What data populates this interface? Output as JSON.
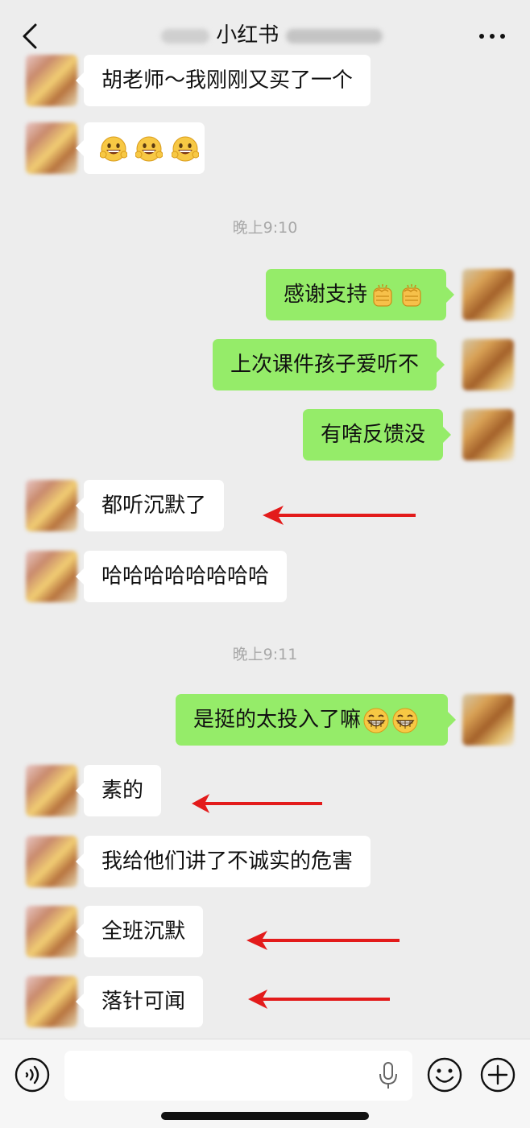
{
  "header": {
    "title_visible": "小红书",
    "back_icon": "chevron-left-icon",
    "more_icon": "ellipsis-icon"
  },
  "messages": [
    {
      "side": "left",
      "text": "胡老师～我刚刚又买了一个"
    },
    {
      "side": "left",
      "emoji": [
        "grinning-face",
        "grinning-face",
        "grinning-face"
      ]
    },
    {
      "side": "right",
      "text": "感谢支持",
      "emoji": [
        "raised-fist",
        "raised-fist"
      ]
    },
    {
      "side": "right",
      "text": "上次课件孩子爱听不"
    },
    {
      "side": "right",
      "text": "有啥反馈没"
    },
    {
      "side": "left",
      "text": "都听沉默了",
      "annotated_arrow": true
    },
    {
      "side": "left",
      "text": "哈哈哈哈哈哈哈哈"
    },
    {
      "side": "right",
      "text": "是挺的太投入了嘛",
      "emoji": [
        "beaming-face",
        "beaming-face"
      ]
    },
    {
      "side": "left",
      "text": "素的",
      "annotated_arrow": true
    },
    {
      "side": "left",
      "text": "我给他们讲了不诚实的危害"
    },
    {
      "side": "left",
      "text": "全班沉默",
      "annotated_arrow": true
    },
    {
      "side": "left",
      "text": "落针可闻",
      "annotated_arrow": true
    }
  ],
  "timestamps": [
    "晚上9:10",
    "晚上9:11"
  ],
  "input_bar": {
    "voice_icon": "voice-icon",
    "mic_icon": "microphone-icon",
    "emoji_icon": "smiley-icon",
    "plus_icon": "plus-icon"
  },
  "colors": {
    "background": "#ededed",
    "left_bubble": "#ffffff",
    "right_bubble": "#95ec69",
    "arrow": "#e31b1b"
  }
}
